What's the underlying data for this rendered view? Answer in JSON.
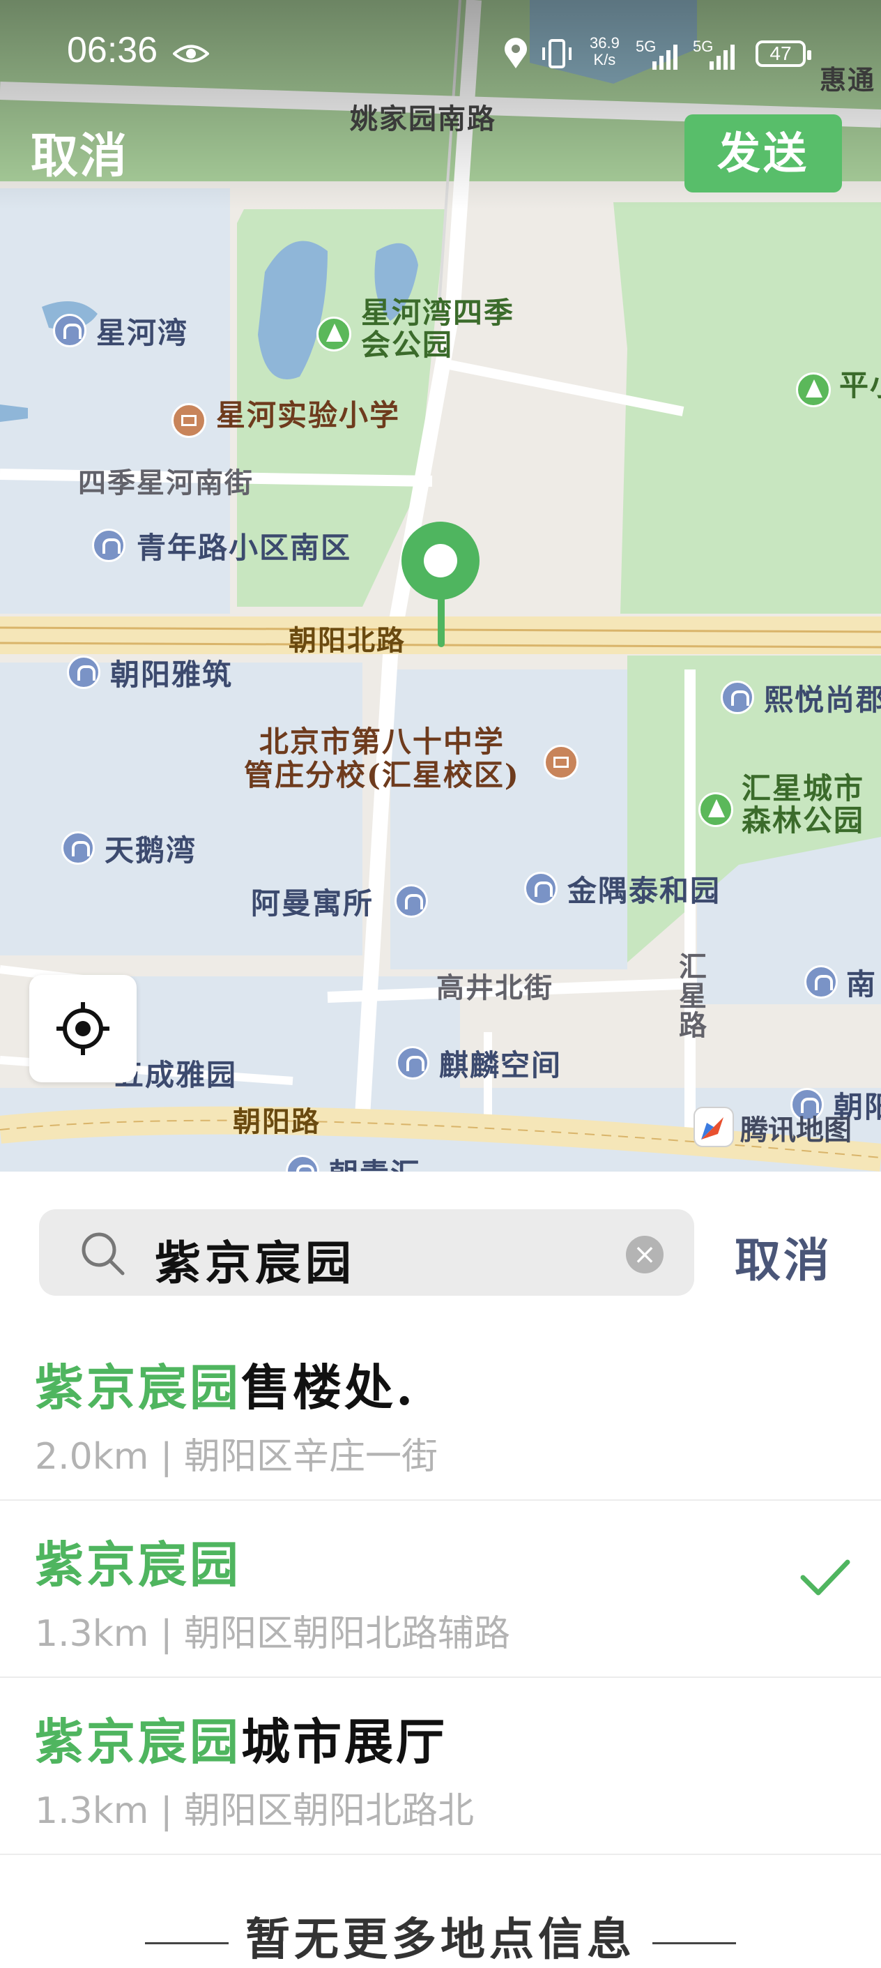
{
  "status_bar": {
    "time": "06:36",
    "net_speed_value": "36.9",
    "net_speed_unit": "K/s",
    "signal_1": "5G",
    "signal_2": "5G",
    "battery": "47"
  },
  "header": {
    "cancel_label": "取消",
    "send_label": "发送"
  },
  "map": {
    "poi_labels": {
      "xinghewan": "星河湾",
      "park_siji": "星河湾四季\n会公园",
      "school_xinghe": "星河实验小学",
      "street_siji": "四季星河南街",
      "qingnianlu": "青年路小区南区",
      "chaoyang_north_road": "朝阳北路",
      "chaoyang_yazhu": "朝阳雅筑",
      "school_80": "北京市第八十中学\n管庄分校(汇星校区)",
      "xiyue": "熙悦尚郡",
      "park_huixing": "汇星城市\n森林公园",
      "tianewan": "天鹅湾",
      "amanyu": "阿曼寓所",
      "jinyu": "金隅泰和园",
      "gaojing": "高井北街",
      "huixinglu": "汇\n星\n路",
      "chengyayuan": "五成雅园",
      "qilin": "麒麟空间",
      "chaoyanglu": "朝阳路",
      "yaojia": "姚家园南路",
      "huitong": "惠通",
      "ping": "平小",
      "nan": "南",
      "chaoyang_edge": "朝阳",
      "chaoqing": "朝青汇"
    },
    "brand": "腾讯地图",
    "locate_icon": "locate-icon",
    "marker_icon": "location-pin-icon"
  },
  "search": {
    "query": "紫京宸园",
    "cancel_label": "取消",
    "clear_icon": "clear-icon",
    "search_icon": "search-icon"
  },
  "results": [
    {
      "highlight": "紫京宸园",
      "rest": "售楼处.",
      "meta": "2.0km | 朝阳区辛庄一街",
      "selected": false
    },
    {
      "highlight": "紫京宸园",
      "rest": "",
      "meta": "1.3km | 朝阳区朝阳北路辅路",
      "selected": true
    },
    {
      "highlight": "紫京宸园",
      "rest": "城市展厅",
      "meta": "1.3km | 朝阳区朝阳北路北",
      "selected": false
    }
  ],
  "footer_note": "暂无更多地点信息",
  "colors": {
    "accent_green": "#58be6a",
    "highlight_green": "#4fb55f",
    "cancel_blue": "#4a5678"
  }
}
